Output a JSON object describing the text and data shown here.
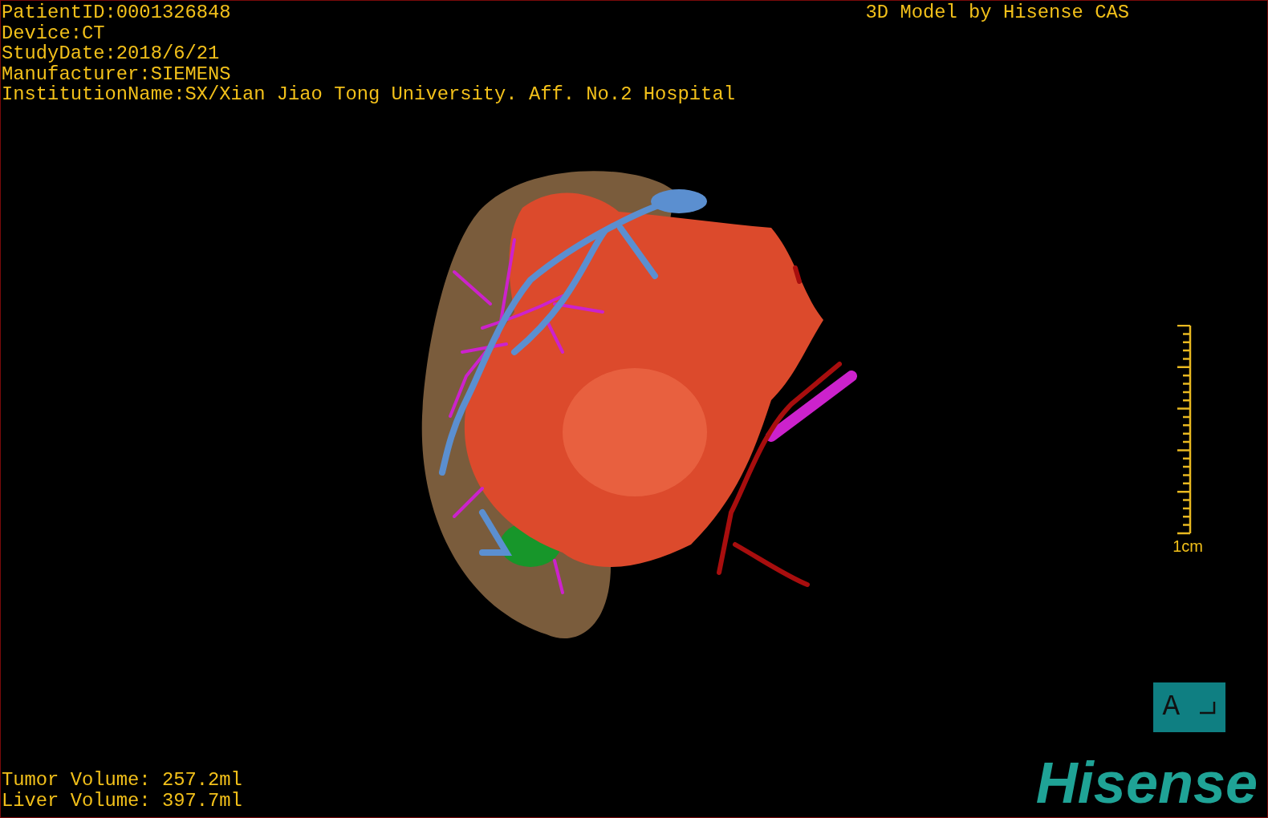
{
  "header": {
    "info_lines": [
      "PatientID:0001326848",
      "Device:CT",
      "StudyDate:2018/6/21",
      "Manufacturer:SIEMENS",
      "InstitutionName:SX/Xian Jiao Tong University. Aff. No.2 Hospital"
    ],
    "title": "3D Model by Hisense CAS"
  },
  "scale_bar": {
    "label": "1cm"
  },
  "orientation": {
    "label": "A"
  },
  "volumes": [
    "Tumor Volume: 257.2ml",
    "Liver Volume: 397.7ml"
  ],
  "logo": {
    "text": "Hisense"
  }
}
